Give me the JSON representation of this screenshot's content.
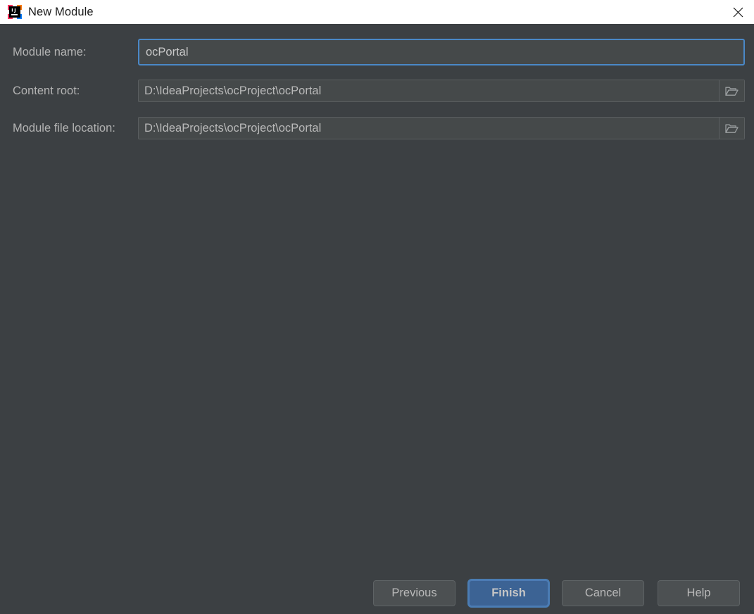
{
  "window": {
    "title": "New Module",
    "app_icon": "intellij-idea-icon",
    "close_icon": "close-icon",
    "titlebar_bg": "#ffffff",
    "body_bg": "#3c4043"
  },
  "form": {
    "fields": [
      {
        "key": "module-name",
        "label": "Module name:",
        "value": "ocPortal",
        "placeholder": "",
        "focused": true,
        "has_browse": false
      },
      {
        "key": "content-root",
        "label": "Content root:",
        "value": "D:\\IdeaProjects\\ocProject\\ocPortal",
        "placeholder": "",
        "focused": false,
        "has_browse": true,
        "browse_icon": "folder-icon"
      },
      {
        "key": "module-file-location",
        "label": "Module file location:",
        "value": "D:\\IdeaProjects\\ocProject\\ocPortal",
        "placeholder": "",
        "focused": false,
        "has_browse": true,
        "browse_icon": "folder-icon"
      }
    ]
  },
  "footer": {
    "buttons": [
      {
        "key": "previous",
        "label": "Previous",
        "primary": false
      },
      {
        "key": "finish",
        "label": "Finish",
        "primary": true
      },
      {
        "key": "cancel",
        "label": "Cancel",
        "primary": false
      },
      {
        "key": "help",
        "label": "Help",
        "primary": false
      }
    ]
  },
  "colors": {
    "accent_focus": "#4a88c7",
    "primary_button": "#3c6394",
    "field_bg": "#45494a",
    "text": "#b9b9b9"
  }
}
